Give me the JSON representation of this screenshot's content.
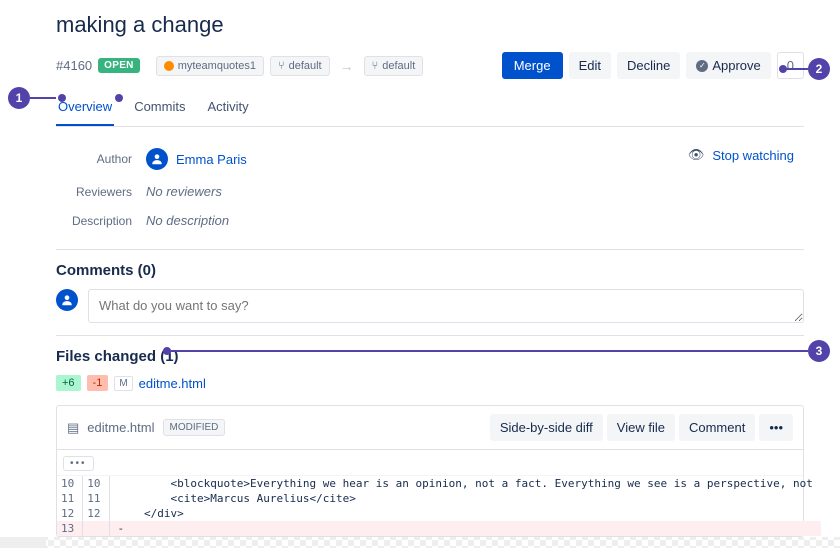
{
  "title": "making a change",
  "pr_id": "#4160",
  "state": "OPEN",
  "source_repo": "myteamquotes1",
  "source_branch": "default",
  "dest_branch": "default",
  "actions": {
    "merge": "Merge",
    "edit": "Edit",
    "decline": "Decline",
    "approve": "Approve",
    "count": "0"
  },
  "tabs": {
    "overview": "Overview",
    "commits": "Commits",
    "activity": "Activity"
  },
  "info": {
    "author_label": "Author",
    "author_name": "Emma Paris",
    "reviewers_label": "Reviewers",
    "reviewers_value": "No reviewers",
    "description_label": "Description",
    "description_value": "No description"
  },
  "stop_watching": "Stop watching",
  "comments": {
    "title": "Comments (0)",
    "placeholder": "What do you want to say?"
  },
  "files": {
    "title": "Files changed (1)",
    "added": "+6",
    "removed": "-1",
    "m": "M",
    "filename": "editme.html"
  },
  "file_panel": {
    "name": "editme.html",
    "status": "MODIFIED",
    "side_by_side": "Side-by-side diff",
    "view_file": "View file",
    "comment": "Comment",
    "more": "•••",
    "ellipsis": "•••",
    "lines": [
      {
        "old": "10",
        "new": "10",
        "text": "        <blockquote>Everything we hear is an opinion, not a fact. Everything we see is a perspective, not"
      },
      {
        "old": "11",
        "new": "11",
        "text": "        <cite>Marcus Aurelius</cite>"
      },
      {
        "old": "12",
        "new": "12",
        "text": "    </div>"
      },
      {
        "old": "13",
        "new": "",
        "text": "-",
        "del": true
      }
    ]
  },
  "callouts": {
    "c1": "1",
    "c2": "2",
    "c3": "3"
  }
}
